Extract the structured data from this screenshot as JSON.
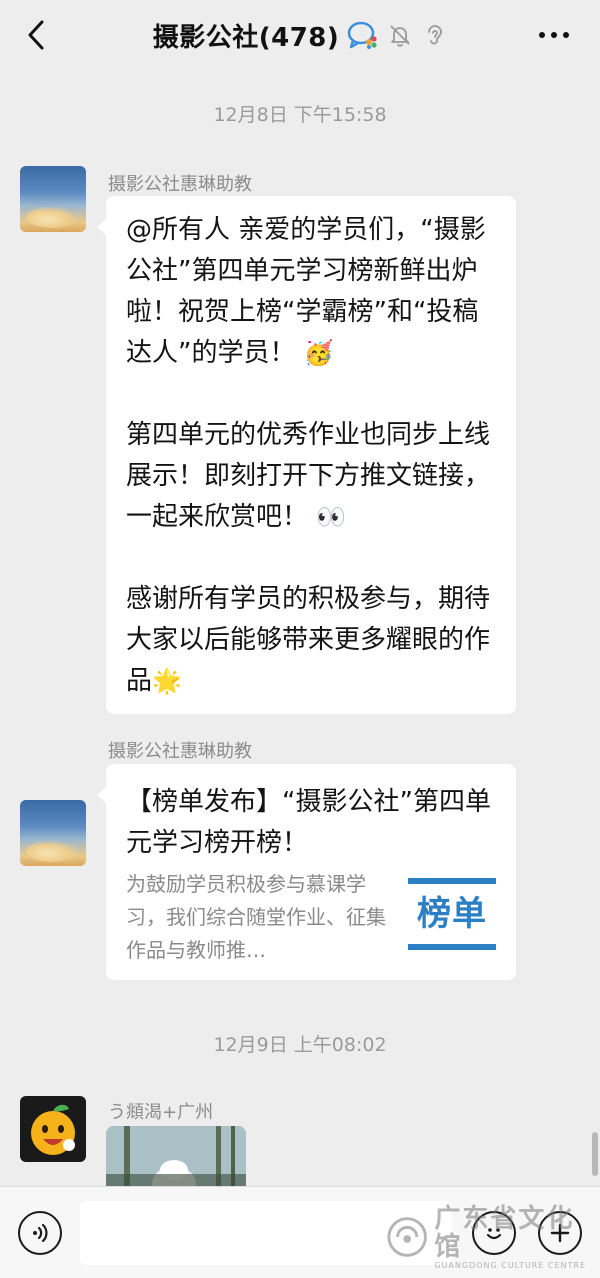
{
  "header": {
    "title": "摄影公社(478)"
  },
  "timestamps": {
    "first": "12月8日 下午15:58",
    "second": "12月9日 上午08:02"
  },
  "messages": [
    {
      "sender": "摄影公社惠琳助教",
      "paragraphs": [
        "@所有人 亲爱的学员们，“摄影公社”第四单元学习榜新鲜出炉啦！祝贺上榜“学霸榜”和“投稿达人”的学员！",
        "第四单元的优秀作业也同步上线展示！即刻打开下方推文链接，一起来欣赏吧！",
        "感谢所有学员的积极参与，期待大家以后能够带来更多耀眼的作品"
      ],
      "emojis": [
        "🥳",
        "👀",
        "🌟"
      ]
    },
    {
      "sender": "摄影公社惠琳助教",
      "card": {
        "title": "【榜单发布】“摄影公社”第四单元学习榜开榜！",
        "description": "为鼓励学员积极参与慕课学习，我们综合随堂作业、征集作品与教师推…",
        "thumb_text": "榜单",
        "thumb_color": "#2a7fc5"
      }
    },
    {
      "sender": "う頫渴+广州"
    }
  ],
  "watermark": {
    "text": "广东省文化馆",
    "sub": "GUANGDONG CULTURE CENTRE"
  },
  "colors": {
    "background": "#ededed",
    "bubble": "#ffffff",
    "accent": "#2a7fc5"
  }
}
